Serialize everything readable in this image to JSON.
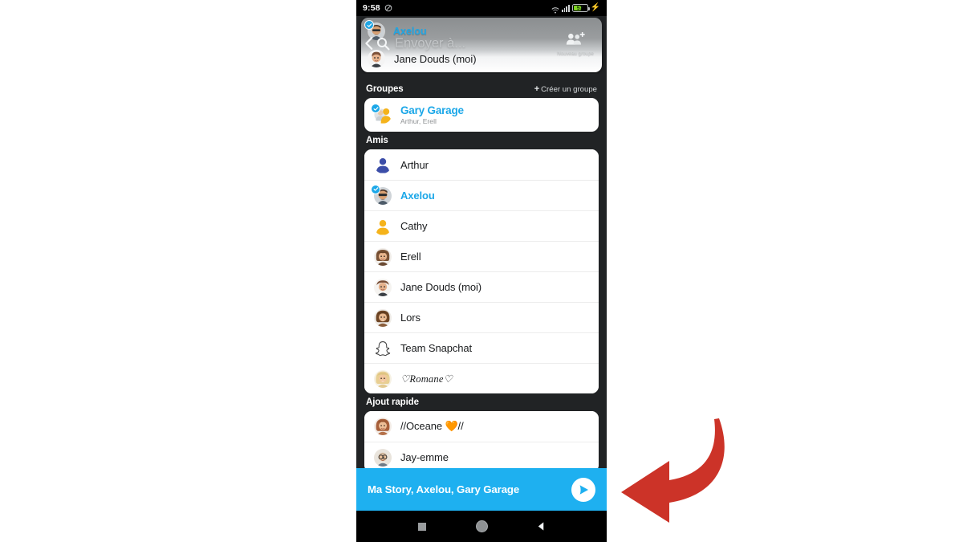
{
  "statusbar": {
    "time": "9:58",
    "mute_icon": "bell-mute-icon",
    "wifi_icon": "wifi-icon",
    "signal_icon": "signal-bars-icon",
    "battery_percent": "57",
    "battery_fill_pct": 57,
    "charging_icon": "lightning-bolt-icon",
    "battery_color": "#7ED321"
  },
  "header": {
    "back_icon": "back-chevron-icon",
    "search_icon": "search-icon",
    "search_placeholder": "Envoyer à...",
    "new_group_icon": "group-add-icon",
    "new_group_label": "Nouveau groupe",
    "ghost_row_name": "Axelou",
    "ghost_row_me": "Jane Douds (moi)"
  },
  "sections": [
    {
      "name": "groupes",
      "title": "Groupes",
      "action_plus": "+",
      "action_label": "Créer un groupe",
      "rows": [
        {
          "name": "Gary Garage",
          "members": "Arthur, Erell",
          "selected": true,
          "avatar": "group-bitmoji-avatar"
        }
      ]
    },
    {
      "name": "amis",
      "title": "Amis",
      "rows": [
        {
          "name": "Arthur",
          "selected": false,
          "avatar": "default-silhouette-indigo"
        },
        {
          "name": "Axelou",
          "selected": true,
          "avatar": "bitmoji-sunglasses-avatar"
        },
        {
          "name": "Cathy",
          "selected": false,
          "avatar": "default-silhouette-yellow"
        },
        {
          "name": "Erell",
          "selected": false,
          "avatar": "bitmoji-brown-hair-avatar"
        },
        {
          "name": "Jane Douds (moi)",
          "selected": false,
          "avatar": "bitmoji-me-avatar"
        },
        {
          "name": "Lors",
          "selected": false,
          "avatar": "bitmoji-bob-hair-avatar"
        },
        {
          "name": "Team Snapchat",
          "selected": false,
          "avatar": "snapchat-ghost-icon"
        },
        {
          "name": "♡Romane♡",
          "selected": false,
          "avatar": "bitmoji-blonde-avatar",
          "script": true
        }
      ]
    },
    {
      "name": "ajout-rapide",
      "title": "Ajout rapide",
      "rows": [
        {
          "name": "//Oceane 🧡//",
          "selected": false,
          "avatar": "bitmoji-ginger-avatar"
        },
        {
          "name": "Jay-emme",
          "selected": false,
          "avatar": "bitmoji-glasses-avatar"
        }
      ]
    }
  ],
  "sendbar": {
    "recipients": "Ma Story, Axelou, Gary Garage",
    "send_icon": "send-arrow-icon",
    "color": "#1EB0F0"
  },
  "navbar": {
    "recents_icon": "square-recents-icon",
    "home_icon": "circle-home-icon",
    "back_icon": "triangle-back-icon"
  },
  "annotation": {
    "arrow_icon": "curved-left-arrow-annotation",
    "color": "#CC3328"
  },
  "theme": {
    "accent_blue": "#1BA7E8",
    "send_blue": "#1EB0F0",
    "app_background": "#212325",
    "card_white": "#FFFFFF"
  }
}
